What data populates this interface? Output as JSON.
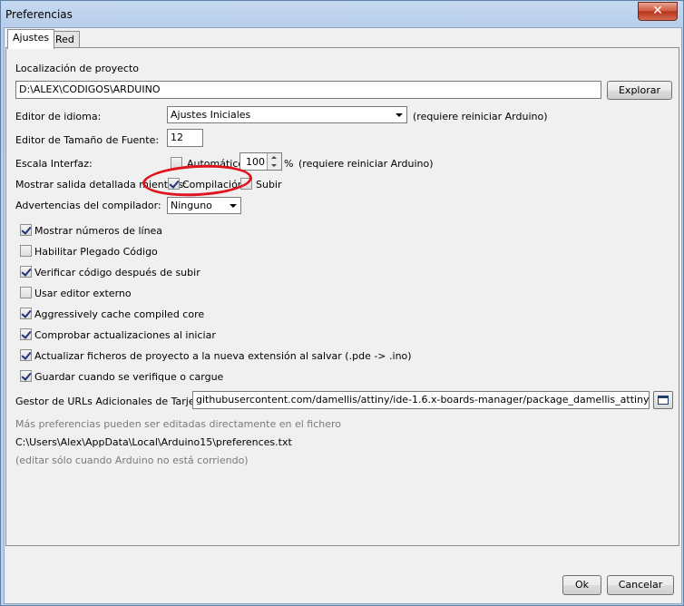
{
  "window": {
    "title": "Preferencias",
    "close_glyph": "✕"
  },
  "tabs": [
    {
      "label": "Ajustes",
      "active": true
    },
    {
      "label": "Red",
      "active": false
    }
  ],
  "sketchbook": {
    "label": "Localización de proyecto",
    "path": "D:\\ALEX\\CODIGOS\\ARDUINO",
    "browse_label": "Explorar"
  },
  "language": {
    "label": "Editor de idioma:",
    "selected": "Ajustes Iniciales",
    "note": "(requiere reiniciar Arduino)"
  },
  "font_size": {
    "label": "Editor de Tamaño de Fuente:",
    "value": "12"
  },
  "scale": {
    "label": "Escala Interfaz:",
    "auto_label": "Automático",
    "auto_checked": false,
    "value": "100",
    "unit": "%",
    "note": "(requiere reiniciar Arduino)"
  },
  "verbose": {
    "label": "Mostrar salida detallada mientras:",
    "compile_label": "Compilación",
    "compile_checked": true,
    "upload_label": "Subir",
    "upload_checked": false
  },
  "warnings": {
    "label": "Advertencias del compilador:",
    "selected": "Ninguno"
  },
  "options": [
    {
      "label": "Mostrar números de línea",
      "checked": true
    },
    {
      "label": "Habilitar Plegado Código",
      "checked": false
    },
    {
      "label": "Verificar código después de subir",
      "checked": true
    },
    {
      "label": "Usar editor externo",
      "checked": false
    },
    {
      "label": "Aggressively cache compiled core",
      "checked": true
    },
    {
      "label": "Comprobar actualizaciones al iniciar",
      "checked": true
    },
    {
      "label": "Actualizar ficheros de proyecto a la nueva extensión al salvar (.pde -> .ino)",
      "checked": true
    },
    {
      "label": "Guardar cuando se verifique o cargue",
      "checked": true
    }
  ],
  "board_urls": {
    "label": "Gestor de URLs Adicionales de Tarjetas:",
    "value": "githubusercontent.com/damellis/attiny/ide-1.6.x-boards-manager/package_damellis_attiny_index.json",
    "icon": "window-icon"
  },
  "footer": {
    "more_prefs": "Más preferencias pueden ser editadas directamente en el fichero",
    "prefs_path": "C:\\Users\\Alex\\AppData\\Local\\Arduino15\\preferences.txt",
    "edit_note": "(editar sólo cuando Arduino no está corriendo)"
  },
  "buttons": {
    "ok": "Ok",
    "cancel": "Cancelar"
  },
  "colors": {
    "annotation_circle": "#e0141e",
    "title_bar": "#c5d9f1",
    "close_button": "#c7452a"
  }
}
